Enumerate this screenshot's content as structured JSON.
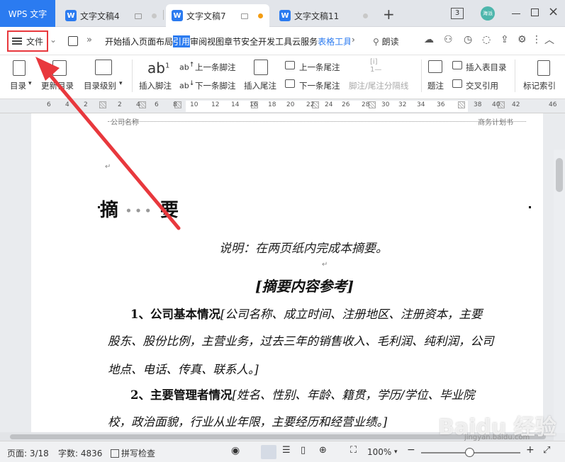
{
  "app": {
    "brand_tab": "WPS 文字"
  },
  "tabs": [
    {
      "label": "文字文稿4"
    },
    {
      "label": "文字文稿7"
    },
    {
      "label": "文字文稿11"
    }
  ],
  "title_right": {
    "badge": "3",
    "avatar_text": "海派"
  },
  "menubar": {
    "file_label": "文件",
    "items": [
      "开始",
      "插入",
      "页面布局",
      "引用",
      "审阅",
      "视图",
      "章节",
      "安全",
      "开发工具",
      "云服务",
      "表格工具"
    ],
    "active_item": "引用",
    "read_aloud": "朗读"
  },
  "ribbon": {
    "toc": "目录",
    "update_toc": "更新目录",
    "toc_level": "目录级别",
    "insert_footnote": "插入脚注",
    "prev_footnote": "上一条脚注",
    "next_footnote": "下一条脚注",
    "insert_endnote": "插入尾注",
    "prev_endnote": "上一条尾注",
    "next_endnote": "下一条尾注",
    "footnote_separator": "脚注/尾注分隔线",
    "caption": "题注",
    "insert_table_toc": "插入表目录",
    "cross_reference": "交叉引用",
    "mark_index": "标记索引"
  },
  "ruler": {
    "numbers": [
      "6",
      "4",
      "2",
      "2",
      "4",
      "6",
      "8",
      "10",
      "12",
      "14",
      "16",
      "18",
      "20",
      "22",
      "24",
      "26",
      "28",
      "30",
      "32",
      "34",
      "36",
      "38",
      "40",
      "42",
      "46"
    ]
  },
  "document": {
    "header_left": "公司名称",
    "header_right": "商务计划书",
    "heading_left": "摘",
    "heading_dots": "•••",
    "heading_right": "要",
    "note": "说明：在两页纸内完成本摘要。",
    "subhead": "[摘要内容参考]",
    "p1_title": "1、公司基本情况",
    "p1_line1": "[公司名称、成立时间、注册地区、注册资本，主要",
    "p1_line2": "股东、股份比例，主营业务，过去三年的销售收入、毛利润、纯利润，公司",
    "p1_line3": "地点、电话、传真、联系人。]",
    "p2_title": "2、主要管理者情况",
    "p2_line1": "[姓名、性别、年龄、籍贯，学历/学位、毕业院",
    "p2_line2": "校，政治面貌，行业从业年限，主要经历和经营业绩。]"
  },
  "statusbar": {
    "page": "页面: 3/18",
    "word_count": "字数: 4836",
    "spell_check": "拼写检查",
    "zoom": "100%"
  },
  "watermark": {
    "main": "Baidu 经验",
    "sub": "jingyan.baidu.com"
  },
  "colors": {
    "accent": "#2b7bf0",
    "highlight_border": "#e8383d",
    "arrow": "#e8383d"
  }
}
